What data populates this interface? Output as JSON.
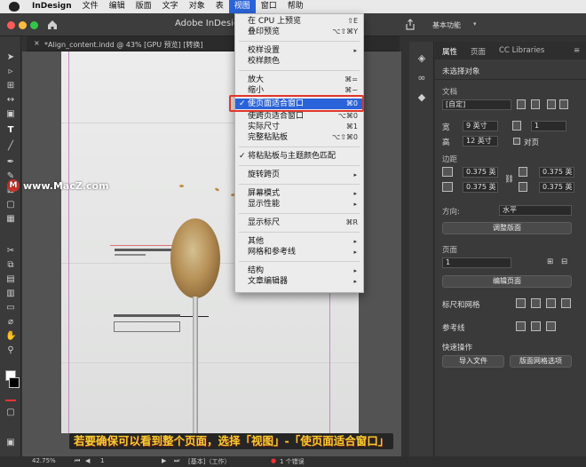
{
  "menubar": {
    "app": "InDesign",
    "items": [
      "文件",
      "编辑",
      "版面",
      "文字",
      "对象",
      "表",
      "视图",
      "窗口",
      "帮助"
    ],
    "active_index": 6
  },
  "appbar": {
    "title": "Adobe InDesign",
    "workspace": "基本功能"
  },
  "document_tab": {
    "close": "×",
    "title": "*Align_content.indd @ 43% [GPU 预览] [转换]"
  },
  "view_menu": {
    "items": [
      {
        "label": "在 CPU 上预览",
        "shortcut": "⇧E"
      },
      {
        "label": "叠印预览",
        "shortcut": "⌥⇧⌘Y"
      },
      {
        "label": "校样设置",
        "submenu": "▸"
      },
      {
        "label": "校样颜色",
        "shortcut": ""
      },
      {
        "label": "放大",
        "shortcut": "⌘="
      },
      {
        "label": "缩小",
        "shortcut": "⌘−"
      },
      {
        "label": "使页面适合窗口",
        "shortcut": "⌘0",
        "checked": true,
        "highlighted": true
      },
      {
        "label": "使跨页适合窗口",
        "shortcut": "⌥⌘0"
      },
      {
        "label": "实际尺寸",
        "shortcut": "⌘1"
      },
      {
        "label": "完整粘贴板",
        "shortcut": "⌥⇧⌘0"
      },
      {
        "label": "将粘贴板与主题颜色匹配",
        "checked": true
      },
      {
        "label": "旋转跨页",
        "submenu": "▸"
      },
      {
        "label": "屏幕模式",
        "submenu": "▸"
      },
      {
        "label": "显示性能",
        "submenu": "▸"
      },
      {
        "label": "显示标尺",
        "shortcut": "⌘R"
      },
      {
        "label": "其他",
        "submenu": "▸"
      },
      {
        "label": "网格和参考线",
        "submenu": "▸"
      },
      {
        "label": "结构",
        "submenu": "▸"
      },
      {
        "label": "文章编辑器",
        "submenu": "▸"
      }
    ],
    "check_mark": "✓"
  },
  "watermark": {
    "logo": "M",
    "text": "www.MacZ.com"
  },
  "panel": {
    "tabs": [
      "属性",
      "页面",
      "CC Libraries"
    ],
    "no_selection": "未选择对象",
    "document_label": "文档",
    "preset": "[自定]",
    "width_label": "宽",
    "width_value": "9 英寸",
    "height_label": "高",
    "height_value": "12 英寸",
    "pages_count": "1",
    "facing_pages": "对页",
    "margins_label": "边距",
    "margin_values": [
      "0.375 英",
      "0.375 英",
      "0.375 英",
      "0.375 英"
    ],
    "orientation_label": "方向:",
    "orientation_value": "水平",
    "adjust_layout": "调整版面",
    "page_label": "页面",
    "page_value": "1",
    "edit_page": "编辑页面",
    "rulers_grids": "标尺和网格",
    "guides": "参考线",
    "quick_actions": "快速操作",
    "import_file": "导入文件",
    "layout_grid_options": "版面网格选项"
  },
  "status": {
    "zoom": "42.75%",
    "page": "1",
    "master": "[基本]（工作）",
    "preflight": "1 个错误"
  },
  "caption": "若要确保可以看到整个页面，选择「视图」-「使页面适合窗口」",
  "colors": {
    "accent": "#2a63d9",
    "highlight_box": "#e0352b",
    "caption": "#f2cf31"
  }
}
